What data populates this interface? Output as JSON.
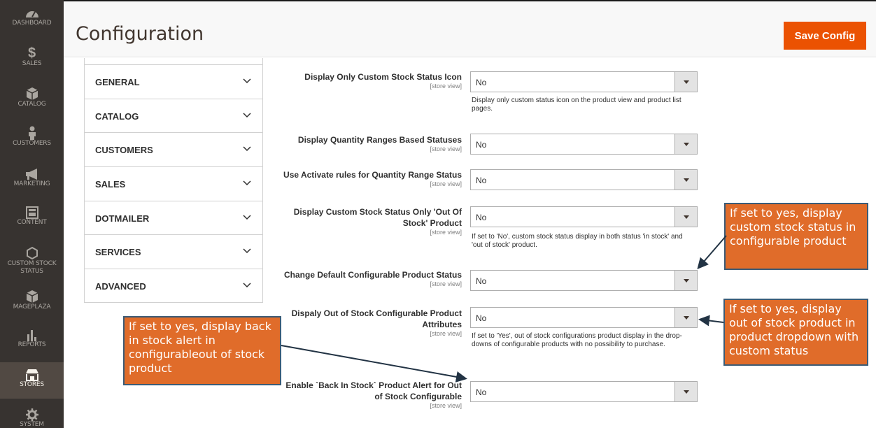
{
  "menu": {
    "items": [
      {
        "label": "DASHBOARD",
        "icon": "dashboard-icon"
      },
      {
        "label": "SALES",
        "icon": "dollar-icon"
      },
      {
        "label": "CATALOG",
        "icon": "cube-icon"
      },
      {
        "label": "CUSTOMERS",
        "icon": "person-icon"
      },
      {
        "label": "MARKETING",
        "icon": "megaphone-icon"
      },
      {
        "label": "CONTENT",
        "icon": "layout-icon"
      },
      {
        "label": "CUSTOM STOCK STATUS",
        "icon": "hexagon-icon"
      },
      {
        "label": "MAGEPLAZA",
        "icon": "cube-icon"
      },
      {
        "label": "REPORTS",
        "icon": "bar-chart-icon"
      },
      {
        "label": "STORES",
        "icon": "store-icon"
      },
      {
        "label": "SYSTEM",
        "icon": "gear-icon"
      }
    ],
    "active": "STORES"
  },
  "header": {
    "title": "Configuration",
    "save_label": "Save Config"
  },
  "tabs": [
    "GENERAL",
    "CATALOG",
    "CUSTOMERS",
    "SALES",
    "DOTMAILER",
    "SERVICES",
    "ADVANCED"
  ],
  "fields": [
    {
      "label": "Display Only Custom Stock Status Icon",
      "scope": "[store view]",
      "value": "No",
      "note": "Display only custom status icon on the product view and product list pages."
    },
    {
      "label": "Display Quantity Ranges Based Statuses",
      "scope": "[store view]",
      "value": "No",
      "note": ""
    },
    {
      "label": "Use Activate rules for Quantity Range Status",
      "scope": "[store view]",
      "value": "No",
      "note": ""
    },
    {
      "label": "Display Custom Stock Status Only 'Out Of Stock' Product",
      "scope": "[store view]",
      "value": "No",
      "note": "If set to 'No', custom stock status display in both status 'in stock' and 'out of stock' product."
    },
    {
      "label": "Change Default Configurable Product Status",
      "scope": "[store view]",
      "value": "No",
      "note": ""
    },
    {
      "label": "Dispaly Out of Stock Configurable Product Attributes",
      "scope": "[store view]",
      "value": "No",
      "note": "If set to 'Yes', out of stock configurations product display in the drop-downs of configurable products with no possibility to purchase."
    },
    {
      "label": "Enable `Back In Stock` Product Alert for Out of Stock Configurable",
      "scope": "[store view]",
      "value": "No",
      "note": ""
    }
  ],
  "callouts": {
    "configurable_status": "If set to yes, display custom stock status in configurable product",
    "dropdown_status": "If set to yes, display out of stock product in product dropdown with custom status",
    "back_in_stock": "If set to yes, display back in stock alert in configurableout of stock product"
  },
  "colors": {
    "accent": "#eb5202",
    "menu_bg": "#373330",
    "callout_bg": "#e06c2a",
    "callout_border": "#3b5b76"
  }
}
